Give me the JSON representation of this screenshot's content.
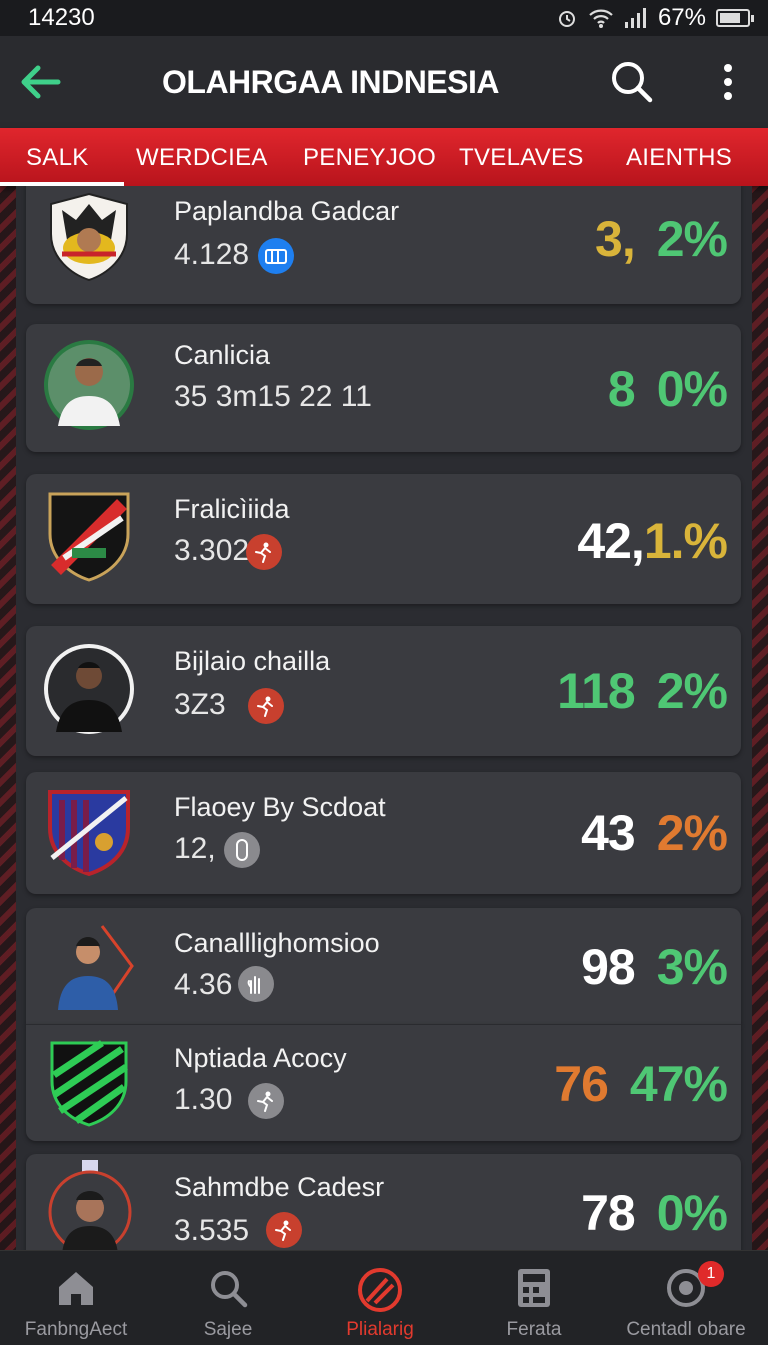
{
  "status": {
    "time": "14230",
    "battery": "67%"
  },
  "app": {
    "title": "OLAHRGAA INDNESIA"
  },
  "tabs": [
    {
      "label": "SALK",
      "active": true
    },
    {
      "label": "WERDCIEA"
    },
    {
      "label": "PENEYJOO"
    },
    {
      "label": "TVELAVES"
    },
    {
      "label": "AIENTHS"
    }
  ],
  "items": [
    {
      "name": "Paplandba Gadcar",
      "stat": "4.128",
      "badge_icon": "chart-badge-icon",
      "badge_color": "#1e7ff0",
      "pct_a": "3,",
      "pct_b": "2%",
      "color_a": "#d9b43a",
      "color_b": "#4fc774"
    },
    {
      "name": "Canlicia",
      "stat": "35 3m15 22 11",
      "badge_icon": "",
      "badge_color": "",
      "pct_a": "8",
      "pct_b": "0%",
      "color_a": "#4fc774",
      "color_b": "#4fc774"
    },
    {
      "name": "Fralicìiida",
      "stat": "3.302",
      "badge_icon": "player-badge-icon",
      "badge_color": "#c8402e",
      "pct_a": "42,",
      "pct_b": "1.%",
      "color_a": "#ffffff",
      "color_b": "#d9b43a"
    },
    {
      "name": "Bijlaio chailla",
      "stat": "3Z3",
      "badge_icon": "player-badge-icon",
      "badge_color": "#c8402e",
      "pct_a": "118",
      "pct_b": "2%",
      "color_a": "#4fc774",
      "color_b": "#4fc774"
    },
    {
      "name": "Flaoey By Scdoat",
      "stat": "12,",
      "badge_icon": "lock-badge-icon",
      "badge_color": "#8a8a8e",
      "pct_a": "43",
      "pct_b": "2%",
      "color_a": "#ffffff",
      "color_b": "#e07a30"
    },
    {
      "name": "Canalllighomsioo",
      "stat": "4.36",
      "badge_icon": "hand-badge-icon",
      "badge_color": "#8a8a8e",
      "pct_a": "98",
      "pct_b": "3%",
      "color_a": "#ffffff",
      "color_b": "#4fc774"
    },
    {
      "name": "Nptiada Acocy",
      "stat": "1.30",
      "badge_icon": "player-badge-icon",
      "badge_color": "#8a8a8e",
      "pct_a": "76",
      "pct_b": "47%",
      "color_a": "#e07a30",
      "color_b": "#4fc774"
    },
    {
      "name": "Sahmdbe Cadesr",
      "stat": "3.535",
      "badge_icon": "player-badge-icon",
      "badge_color": "#c8402e",
      "pct_a": "78",
      "pct_b": "0%",
      "color_a": "#ffffff",
      "color_b": "#4fc774"
    }
  ],
  "nav": [
    {
      "label": "FanbngAect",
      "icon": "home-icon"
    },
    {
      "label": "Sajee",
      "icon": "search-icon"
    },
    {
      "label": "Plialarig",
      "icon": "ball-icon",
      "active": true
    },
    {
      "label": "Ferata",
      "icon": "calculator-icon"
    },
    {
      "label": "Centadl obare",
      "icon": "cart-icon",
      "badge": "1"
    }
  ]
}
